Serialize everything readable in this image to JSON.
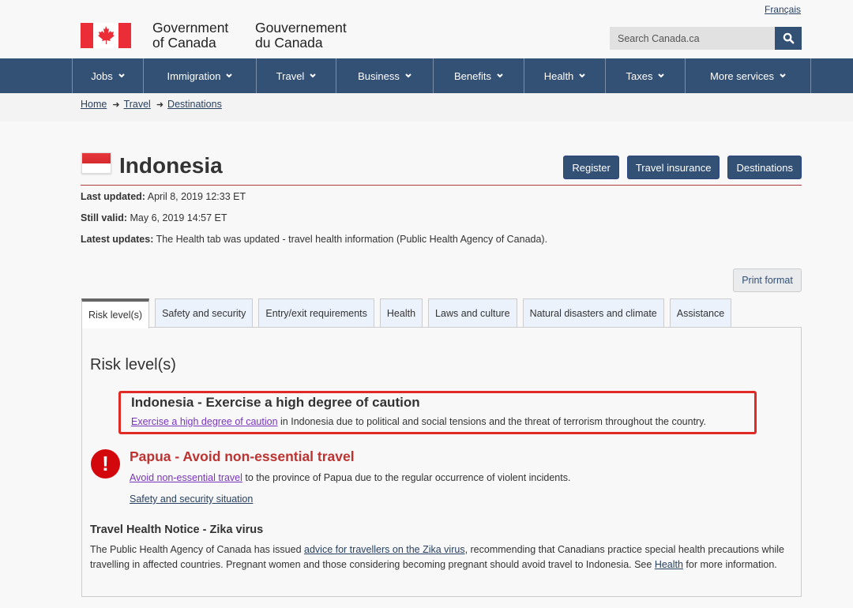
{
  "header": {
    "signature_en": [
      "Government",
      "of Canada"
    ],
    "signature_fr": [
      "Gouvernement",
      "du Canada"
    ],
    "language_link": "Français",
    "search_placeholder": "Search Canada.ca",
    "search_icon": "search-icon"
  },
  "nav": {
    "items": [
      {
        "label": "Jobs"
      },
      {
        "label": "Immigration"
      },
      {
        "label": "Travel"
      },
      {
        "label": "Business"
      },
      {
        "label": "Benefits"
      },
      {
        "label": "Health"
      },
      {
        "label": "Taxes"
      },
      {
        "label": "More services"
      }
    ]
  },
  "breadcrumb": [
    "Home",
    "Travel",
    "Destinations"
  ],
  "page": {
    "title": "Indonesia",
    "buttons": {
      "register": "Register",
      "insurance": "Travel insurance",
      "destinations": "Destinations"
    },
    "last_updated_label": "Last updated:",
    "last_updated_value": " April 8, 2019 12:33 ET",
    "still_valid_label": "Still valid:",
    "still_valid_value": " May 6, 2019 14:57 ET",
    "latest_updates_label": "Latest updates:",
    "latest_updates_value": " The Health tab was updated - travel health information (Public Health Agency of Canada).",
    "print_button": "Print format"
  },
  "tabs": [
    {
      "label": "Risk level(s)",
      "active": true
    },
    {
      "label": "Safety and security"
    },
    {
      "label": "Entry/exit requirements"
    },
    {
      "label": "Health"
    },
    {
      "label": "Laws and culture"
    },
    {
      "label": "Natural disasters and climate"
    },
    {
      "label": "Assistance"
    }
  ],
  "risk": {
    "heading": "Risk level(s)",
    "indonesia": {
      "heading": "Indonesia - Exercise a high degree of caution",
      "link": "Exercise a high degree of caution",
      "text": " in Indonesia due to political and social tensions and the threat of terrorism throughout the country."
    },
    "papua": {
      "heading": "Papua - Avoid non-essential travel",
      "link": "Avoid non-essential travel",
      "text": " to the province of Papua due to the regular occurrence of violent incidents.",
      "more_link": "Safety and security situation"
    },
    "zika": {
      "heading": "Travel Health Notice - Zika virus",
      "text_1": "The Public Health Agency of Canada has issued ",
      "link_1": "advice for travellers on the Zika virus",
      "text_2": ", recommending that Canadians practice special health precautions while travelling in affected countries. Pregnant women and those considering becoming pregnant should avoid travel to Indonesia. See ",
      "link_2": "Health",
      "text_3": " for more information."
    }
  },
  "colors": {
    "nav_bg": "#335075",
    "title_rule": "#af3c43",
    "highlight_box": "#e02a25",
    "alert_red": "#d3080c",
    "papua_heading": "#bc3331",
    "visited_link": "#7834bc"
  }
}
